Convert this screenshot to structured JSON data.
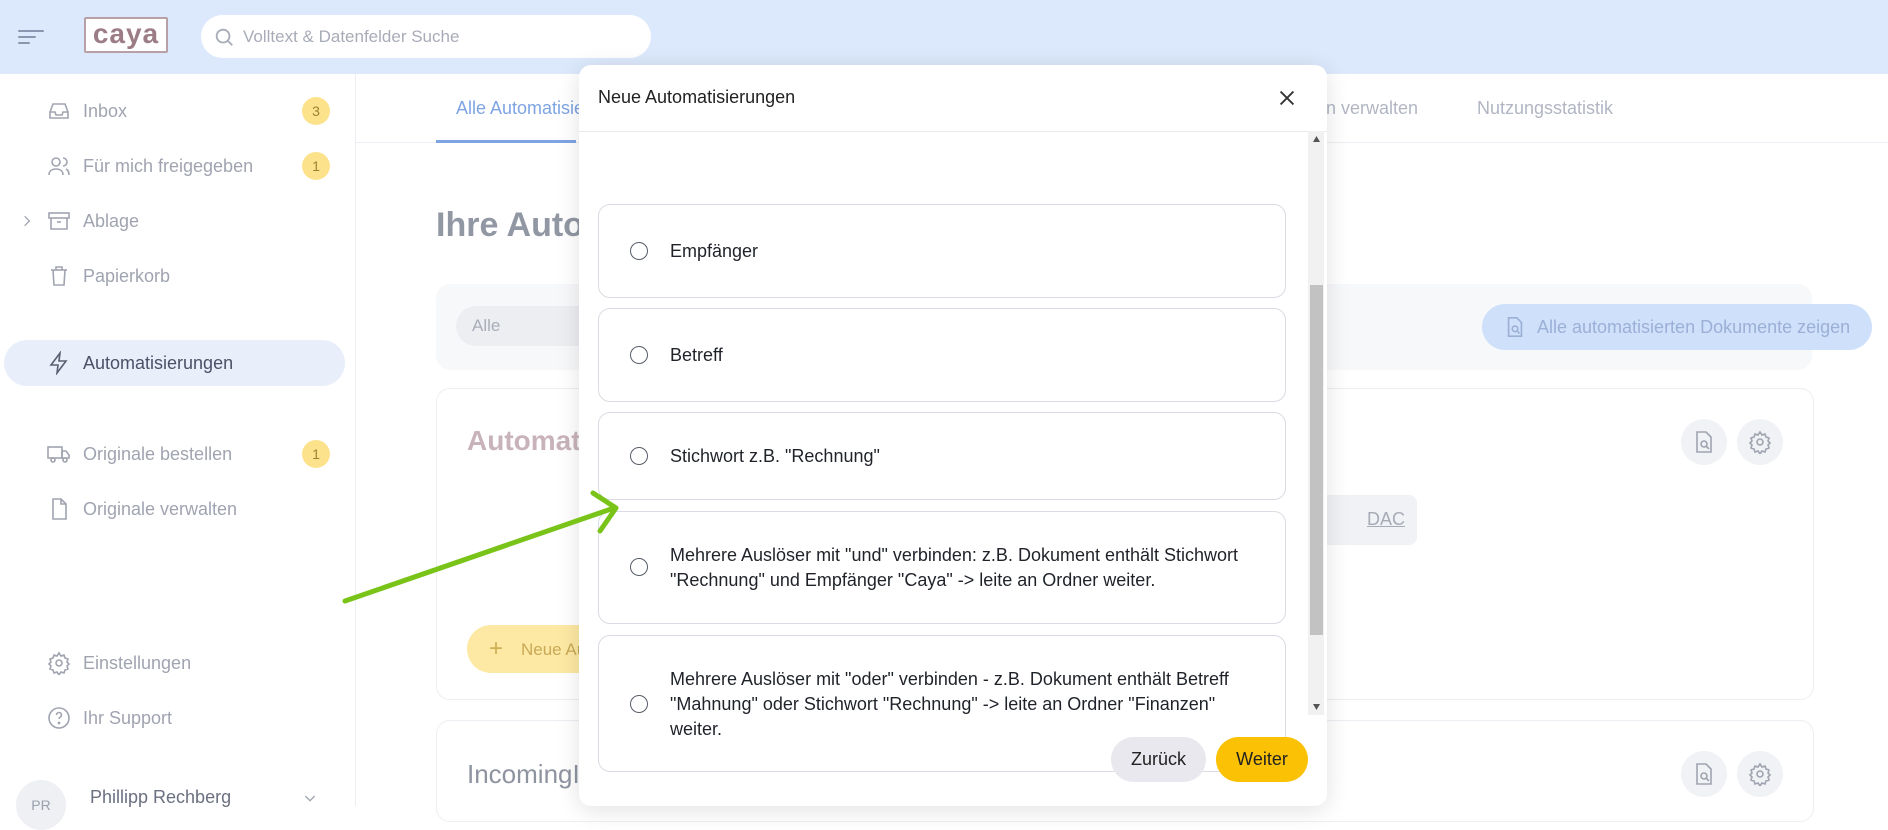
{
  "topbar": {
    "logo_text": "caya",
    "search_placeholder": "Volltext & Datenfelder Suche"
  },
  "sidebar": {
    "items": [
      {
        "label": "Inbox",
        "badge": "3",
        "icon": "inbox-icon"
      },
      {
        "label": "Für mich freigegeben",
        "badge": "1",
        "icon": "users-icon"
      },
      {
        "label": "Ablage",
        "icon": "archive-icon"
      },
      {
        "label": "Papierkorb",
        "icon": "trash-icon"
      },
      {
        "label": "Automatisierungen",
        "icon": "lightning-icon",
        "active": true
      },
      {
        "label": "Originale bestellen",
        "badge": "1",
        "icon": "truck-icon"
      },
      {
        "label": "Originale verwalten",
        "icon": "file-icon"
      },
      {
        "label": "Einstellungen",
        "icon": "gear-icon"
      },
      {
        "label": "Ihr Support",
        "icon": "help-icon"
      }
    ],
    "user": {
      "initials": "PR",
      "name": "Phillipp Rechberg"
    }
  },
  "main": {
    "tabs": [
      {
        "label": "Alle Automatisierungen",
        "active": true
      },
      {
        "label": "en verwalten"
      },
      {
        "label": "Nutzungsstatistik"
      }
    ],
    "page_title": "Ihre Automatisierungen",
    "filter": {
      "select_value": "Alle"
    },
    "show_all_button": "Alle automatisierten Dokumente zeigen",
    "card1": {
      "title": "Automatisierung",
      "chip_text": "DAC",
      "new_button": "Neue Automatisierung"
    },
    "card2": {
      "title": "IncomingI"
    }
  },
  "modal": {
    "title": "Neue Automatisierungen",
    "options": [
      {
        "label": "Empfänger"
      },
      {
        "label": "Betreff"
      },
      {
        "label": "Stichwort z.B. \"Rechnung\""
      },
      {
        "label": "Mehrere Auslöser mit \"und\" verbinden: z.B. Dokument enthält Stichwort \"Rechnung\" und Empfänger \"Caya\" -> leite an Ordner weiter."
      },
      {
        "label": "Mehrere Auslöser mit \"oder\" verbinden - z.B. Dokument enthält Betreff \"Mahnung\" oder Stichwort \"Rechnung\" -> leite an Ordner \"Finanzen\" weiter."
      }
    ],
    "buttons": {
      "back": "Zurück",
      "next": "Weiter"
    }
  },
  "annotation": {
    "arrow_color": "#7ac41a"
  },
  "colors": {
    "accent_blue": "#7ea4e3",
    "primary_yellow": "#fbc105",
    "badge_yellow": "#fde28c",
    "topbar_bg": "#dce8fb"
  }
}
